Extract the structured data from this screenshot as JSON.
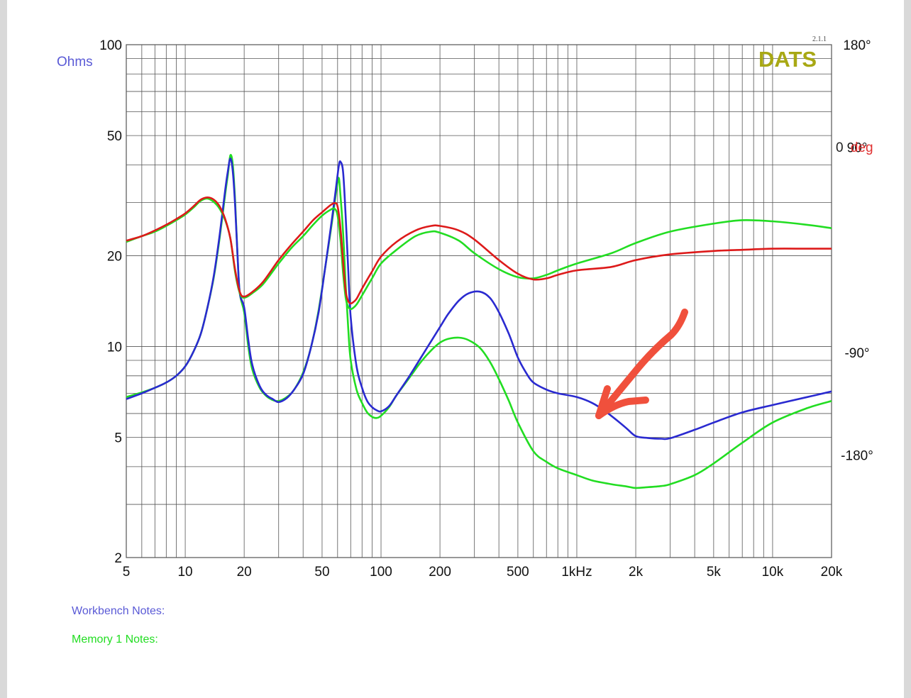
{
  "version_label": "2.1.1",
  "brand": "DATS",
  "colors": {
    "impedance": "#2a2ad0",
    "phase": "#dd1a1a",
    "memory": "#22dd22",
    "brand": "#a8a814",
    "ohms_label": "#5a5ad6",
    "deg_label": "#e03030",
    "grid": "#555555",
    "annotation": "#f0503c"
  },
  "notes": {
    "workbench": "Workbench Notes:",
    "memory": "Memory 1 Notes:"
  },
  "chart_data": {
    "type": "line",
    "title": "",
    "xlabel": "",
    "ylabel": "Ohms",
    "y2label_value": "0",
    "y2label_unit": "deg",
    "x_scale": "log",
    "y_scale": "log",
    "xlim": [
      5,
      20000
    ],
    "ylim": [
      2,
      100
    ],
    "y2lim": [
      -270,
      180
    ],
    "grid": true,
    "x_ticks": [
      {
        "value": 5,
        "label": "5"
      },
      {
        "value": 10,
        "label": "10"
      },
      {
        "value": 20,
        "label": "20"
      },
      {
        "value": 50,
        "label": "50"
      },
      {
        "value": 100,
        "label": "100"
      },
      {
        "value": 200,
        "label": "200"
      },
      {
        "value": 500,
        "label": "500"
      },
      {
        "value": 1000,
        "label": "1kHz"
      },
      {
        "value": 2000,
        "label": "2k"
      },
      {
        "value": 5000,
        "label": "5k"
      },
      {
        "value": 10000,
        "label": "10k"
      },
      {
        "value": 20000,
        "label": "20k"
      }
    ],
    "y_ticks": [
      {
        "value": 100,
        "label": "100"
      },
      {
        "value": 50,
        "label": "50"
      },
      {
        "value": 20,
        "label": "20"
      },
      {
        "value": 10,
        "label": "10"
      },
      {
        "value": 5,
        "label": "5"
      },
      {
        "value": 2,
        "label": "2"
      }
    ],
    "y2_ticks": [
      {
        "value": 180,
        "label": "180°"
      },
      {
        "value": 90,
        "label": "90°"
      },
      {
        "value": -90,
        "label": "-90°"
      },
      {
        "value": -180,
        "label": "-180°"
      }
    ],
    "series": [
      {
        "key": "memory_impedance",
        "color_key": "memory",
        "axis": "left",
        "x": [
          5,
          6,
          7,
          8,
          9,
          10,
          11,
          12,
          13,
          14,
          15,
          16,
          16.5,
          17,
          17.5,
          18,
          18.5,
          19,
          20,
          21,
          22,
          24,
          26,
          28,
          30,
          33,
          36,
          40,
          44,
          48,
          52,
          55,
          58,
          60,
          61,
          62,
          64,
          66,
          68,
          70,
          75,
          80,
          85,
          90,
          95,
          100,
          110,
          120,
          140,
          160,
          180,
          200,
          220,
          250,
          280,
          320,
          360,
          400,
          450,
          500,
          600,
          700,
          800,
          1000,
          1200,
          1500,
          1800,
          2000,
          2300,
          2700,
          3000,
          4000,
          5000,
          7000,
          10000,
          15000,
          20000
        ],
        "y": [
          6.8,
          7.05,
          7.3,
          7.6,
          8.0,
          8.6,
          9.6,
          11.0,
          13.5,
          17.0,
          23.0,
          32.0,
          37.0,
          43.0,
          40.0,
          30.0,
          20.0,
          15.0,
          13.0,
          10.0,
          8.4,
          7.3,
          6.85,
          6.65,
          6.6,
          6.8,
          7.2,
          8.2,
          10.0,
          13.2,
          18.5,
          23.5,
          30.0,
          35.0,
          36.0,
          32.0,
          24.0,
          16.0,
          11.5,
          9.0,
          7.2,
          6.5,
          6.05,
          5.85,
          5.8,
          5.9,
          6.3,
          6.9,
          7.9,
          8.9,
          9.7,
          10.3,
          10.6,
          10.7,
          10.5,
          9.9,
          8.9,
          7.8,
          6.6,
          5.6,
          4.5,
          4.15,
          3.95,
          3.75,
          3.6,
          3.5,
          3.44,
          3.4,
          3.42,
          3.45,
          3.5,
          3.75,
          4.1,
          4.8,
          5.6,
          6.25,
          6.6
        ]
      },
      {
        "key": "workbench_impedance",
        "color_key": "impedance",
        "axis": "left",
        "x": [
          5,
          6,
          7,
          8,
          9,
          10,
          11,
          12,
          13,
          14,
          15,
          16,
          16.5,
          17,
          17.5,
          18,
          18.5,
          19,
          20,
          21,
          22,
          24,
          26,
          28,
          30,
          33,
          36,
          40,
          44,
          48,
          52,
          55,
          58,
          60,
          61,
          62,
          64,
          66,
          68,
          70,
          75,
          80,
          85,
          90,
          95,
          100,
          110,
          120,
          140,
          160,
          180,
          200,
          220,
          250,
          280,
          320,
          360,
          400,
          450,
          500,
          550,
          600,
          700,
          800,
          1000,
          1200,
          1400,
          1600,
          1800,
          2000,
          2300,
          2700,
          3000,
          4000,
          5000,
          7000,
          10000,
          15000,
          20000
        ],
        "y": [
          6.7,
          7.0,
          7.3,
          7.6,
          8.0,
          8.6,
          9.6,
          11.0,
          13.5,
          17.2,
          23.5,
          33.0,
          38.0,
          42.0,
          38.0,
          29.0,
          20.0,
          15.0,
          13.5,
          10.5,
          8.7,
          7.4,
          6.9,
          6.7,
          6.55,
          6.75,
          7.2,
          8.1,
          10.0,
          13.0,
          18.5,
          24.0,
          31.0,
          37.0,
          40.0,
          41.0,
          38.0,
          27.0,
          18.0,
          12.5,
          8.6,
          7.3,
          6.6,
          6.3,
          6.15,
          6.1,
          6.35,
          6.9,
          8.0,
          9.2,
          10.4,
          11.6,
          12.8,
          14.2,
          15.0,
          15.2,
          14.5,
          13.0,
          11.0,
          9.2,
          8.2,
          7.6,
          7.2,
          7.0,
          6.8,
          6.5,
          6.1,
          5.7,
          5.35,
          5.05,
          4.98,
          4.95,
          4.97,
          5.3,
          5.6,
          6.05,
          6.4,
          6.8,
          7.1
        ]
      },
      {
        "key": "memory_phase",
        "color_key": "memory",
        "axis": "right",
        "x": [
          5,
          6,
          7,
          8,
          9,
          10,
          11,
          12,
          13,
          14,
          15,
          16,
          17,
          18,
          19,
          20,
          22,
          25,
          30,
          35,
          40,
          45,
          50,
          55,
          58,
          60,
          62,
          64,
          66,
          68,
          70,
          72,
          75,
          80,
          90,
          100,
          120,
          150,
          180,
          200,
          250,
          300,
          400,
          500,
          600,
          700,
          800,
          1000,
          1500,
          2000,
          3000,
          5000,
          7000,
          10000,
          15000,
          20000
        ],
        "y": [
          7,
          12,
          16,
          21,
          26,
          31,
          37,
          43,
          45,
          42,
          36,
          26,
          10,
          -20,
          -38,
          -42,
          -38,
          -30,
          -12,
          2,
          12,
          22,
          30,
          35,
          36,
          30,
          10,
          -20,
          -42,
          -50,
          -52,
          -51,
          -48,
          -40,
          -25,
          -12,
          0,
          12,
          16,
          15,
          8,
          -3,
          -17,
          -24,
          -25,
          -22,
          -18,
          -12,
          -3,
          6,
          16,
          23,
          26,
          25,
          22,
          19
        ]
      },
      {
        "key": "workbench_phase",
        "color_key": "phase",
        "axis": "right",
        "x": [
          5,
          6,
          7,
          8,
          9,
          10,
          11,
          12,
          13,
          14,
          15,
          16,
          17,
          18,
          19,
          20,
          22,
          25,
          30,
          35,
          40,
          45,
          50,
          55,
          58,
          60,
          62,
          64,
          66,
          68,
          70,
          72,
          75,
          80,
          90,
          100,
          120,
          150,
          180,
          200,
          250,
          300,
          400,
          500,
          600,
          700,
          800,
          1000,
          1500,
          2000,
          3000,
          5000,
          7000,
          10000,
          15000,
          20000
        ],
        "y": [
          8,
          12,
          17,
          22,
          27,
          32,
          38,
          44,
          46,
          44,
          38,
          27,
          10,
          -18,
          -37,
          -41,
          -37,
          -28,
          -9,
          5,
          16,
          26,
          33,
          39,
          41,
          38,
          20,
          -10,
          -36,
          -45,
          -47,
          -46,
          -43,
          -34,
          -19,
          -6,
          7,
          17,
          21,
          21,
          17,
          9,
          -9,
          -21,
          -26,
          -25,
          -22,
          -18,
          -15,
          -9,
          -4,
          -1,
          0,
          1,
          1,
          1
        ]
      }
    ]
  }
}
